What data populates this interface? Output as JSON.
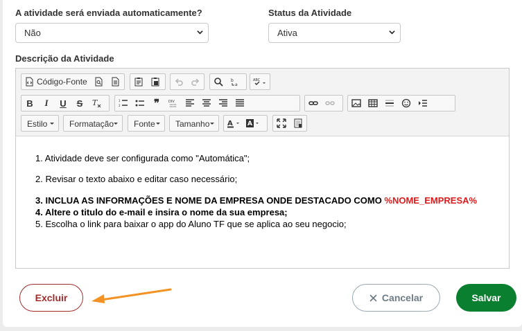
{
  "form": {
    "auto_send": {
      "label": "A atividade será enviada automaticamente?",
      "value": "Não"
    },
    "status": {
      "label": "Status da Atividade",
      "value": "Ativa"
    },
    "description_label": "Descrição da Atividade"
  },
  "toolbar": {
    "source_label": "Código-Fonte",
    "styles_combo": "Estilo",
    "format_combo": "Formatação",
    "font_combo": "Fonte",
    "size_combo": "Tamanho"
  },
  "content": {
    "item1": "1. Atividade deve ser configurada como \"Automática\";",
    "item2": "2. Revisar o texto abaixo e editar caso necessário;",
    "item3": "3. INCLUA AS INFORMAÇÕES E NOME DA EMPRESA ONDE DESTACADO COMO ",
    "item3_highlight": "%NOME_EMPRESA%",
    "item4": "4. Altere o titulo do e-mail e insira o nome da sua empresa;",
    "item5": "5. Escolha o link para baixar o app do Aluno TF que se aplica ao seu negocio;"
  },
  "actions": {
    "delete_label": "Excluir",
    "cancel_label": "Cancelar",
    "save_label": "Salvar"
  },
  "colors": {
    "save_green": "#0a7f2f",
    "delete_red": "#a12b2b",
    "highlight_red": "#e0191a",
    "arrow_orange": "#f39224"
  }
}
